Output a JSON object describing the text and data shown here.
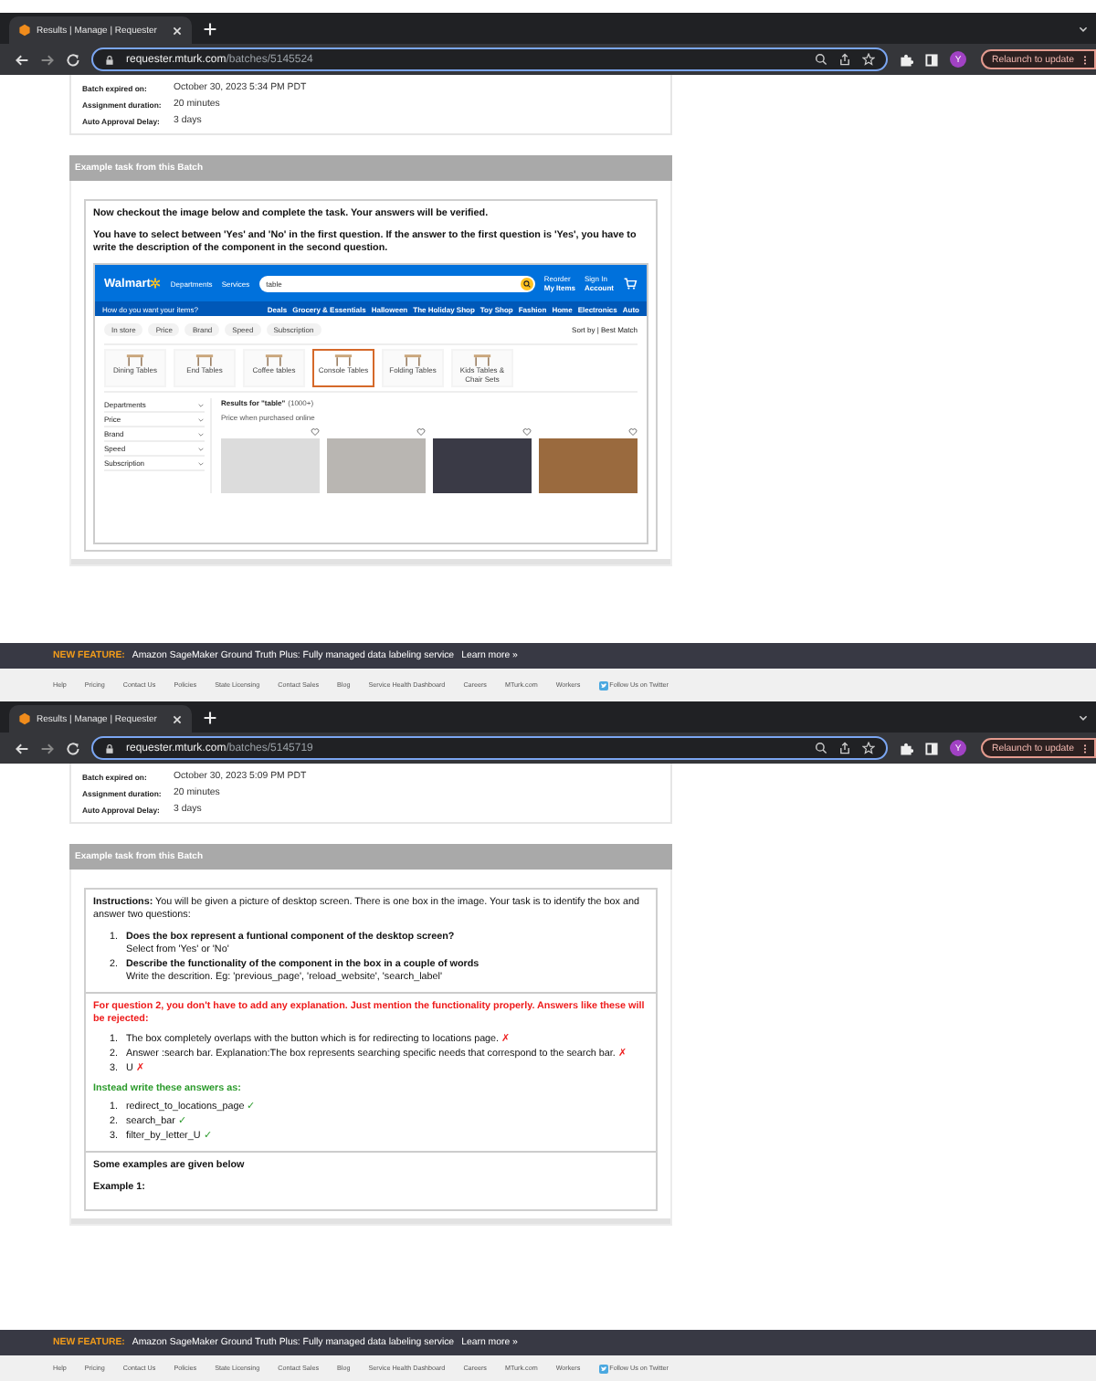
{
  "windows": [
    {
      "browser": {
        "tab_title": "Results | Manage | Requester",
        "url_host": "requester.mturk.com",
        "url_path": "/batches/5145524",
        "update_button": "Relaunch to update",
        "avatar": "Y"
      },
      "batch_info": [
        {
          "label": "Batch expired on:",
          "value": "October 30, 2023 5:34 PM PDT"
        },
        {
          "label": "Assignment duration:",
          "value": "20 minutes"
        },
        {
          "label": "Auto Approval Delay:",
          "value": "3 days"
        }
      ],
      "example_header": "Example task from this Batch",
      "task": {
        "kind": "screenshot",
        "paragraphs": [
          "Now checkout the image below and complete the task. Your answers will be verified.",
          "You have to select between 'Yes' and 'No' in the first question. If the answer to the first question is 'Yes', you have to write the description of the component in the second question."
        ],
        "store": {
          "logo": "Walmart",
          "nav": [
            "Departments",
            "Services"
          ],
          "search": "table",
          "account": [
            {
              "top": "Reorder",
              "bottom": "My Items"
            },
            {
              "top": "Sign In",
              "bottom": "Account"
            }
          ],
          "delivery": "How do you want your items?",
          "menu": [
            "Deals",
            "Grocery & Essentials",
            "Halloween",
            "The Holiday Shop",
            "Toy Shop",
            "Fashion",
            "Home",
            "Electronics",
            "Auto"
          ],
          "chips": [
            "In store",
            "Price",
            "Brand",
            "Speed",
            "Subscription"
          ],
          "sort": "Sort by | Best Match",
          "categories": [
            {
              "label": "Dining Tables",
              "selected": false
            },
            {
              "label": "End Tables",
              "selected": false
            },
            {
              "label": "Coffee tables",
              "selected": false
            },
            {
              "label": "Console Tables",
              "selected": true
            },
            {
              "label": "Folding Tables",
              "selected": false
            },
            {
              "label": "Kids Tables & Chair Sets",
              "selected": false
            }
          ],
          "filters": [
            "Departments",
            "Price",
            "Brand",
            "Speed",
            "Subscription"
          ],
          "results_title": "Results for \"table\"",
          "results_count": "(1000+)",
          "price_note": "Price when purchased online"
        }
      },
      "banner": {
        "label": "NEW FEATURE:",
        "text": "Amazon SageMaker Ground Truth Plus: Fully managed data labeling service",
        "link": "Learn more »"
      },
      "footer": [
        "Help",
        "Pricing",
        "Contact Us",
        "Policies",
        "State Licensing",
        "Contact Sales",
        "Blog",
        "Service Health Dashboard",
        "Careers",
        "MTurk.com",
        "Workers",
        "Follow Us on Twitter"
      ]
    },
    {
      "browser": {
        "tab_title": "Results | Manage | Requester",
        "url_host": "requester.mturk.com",
        "url_path": "/batches/5145719",
        "update_button": "Relaunch to update",
        "avatar": "Y"
      },
      "batch_info": [
        {
          "label": "Batch expired on:",
          "value": "October 30, 2023 5:09 PM PDT"
        },
        {
          "label": "Assignment duration:",
          "value": "20 minutes"
        },
        {
          "label": "Auto Approval Delay:",
          "value": "3 days"
        }
      ],
      "example_header": "Example task from this Batch",
      "task": {
        "kind": "instructions",
        "intro": "**Instructions:** You will be given a picture of desktop screen. There is one box in the image. Your task is to identify the box and answer two questions:",
        "questions": [
          {
            "num": "1.",
            "title": "Does the box represent a funtional component of the desktop screen?",
            "note": "Select from 'Yes' or 'No'"
          },
          {
            "num": "2.",
            "title": "Describe the functionality of the component in the box in a couple of words",
            "note": "Write the descrition. Eg: 'previous_page', 'reload_website', 'search_label'"
          }
        ],
        "warning": "For question 2, you don't have to add any explanation. Just mention the functionality properly. Answers like these will be rejected:",
        "rejected": [
          {
            "num": "1.",
            "text": "The box completely overlaps with the button which is for redirecting to locations page.",
            "mark": "✗"
          },
          {
            "num": "2.",
            "text": "Answer :search bar. Explanation:The box represents searching specific needs that correspond to the search bar.",
            "mark": "✗"
          },
          {
            "num": "3.",
            "text": "U",
            "mark": "✗"
          }
        ],
        "instead": "Instead write these answers as:",
        "accepted": [
          {
            "num": "1.",
            "text": "redirect_to_locations_page",
            "mark": "✓"
          },
          {
            "num": "2.",
            "text": "search_bar",
            "mark": "✓"
          },
          {
            "num": "3.",
            "text": "filter_by_letter_U",
            "mark": "✓"
          }
        ],
        "examples_heading": "Some examples are given below",
        "example_label": "Example 1:"
      },
      "banner": {
        "label": "NEW FEATURE:",
        "text": "Amazon SageMaker Ground Truth Plus: Fully managed data labeling service",
        "link": "Learn more »"
      },
      "footer": [
        "Help",
        "Pricing",
        "Contact Us",
        "Policies",
        "State Licensing",
        "Contact Sales",
        "Blog",
        "Service Health Dashboard",
        "Careers",
        "MTurk.com",
        "Workers",
        "Follow Us on Twitter"
      ]
    }
  ]
}
